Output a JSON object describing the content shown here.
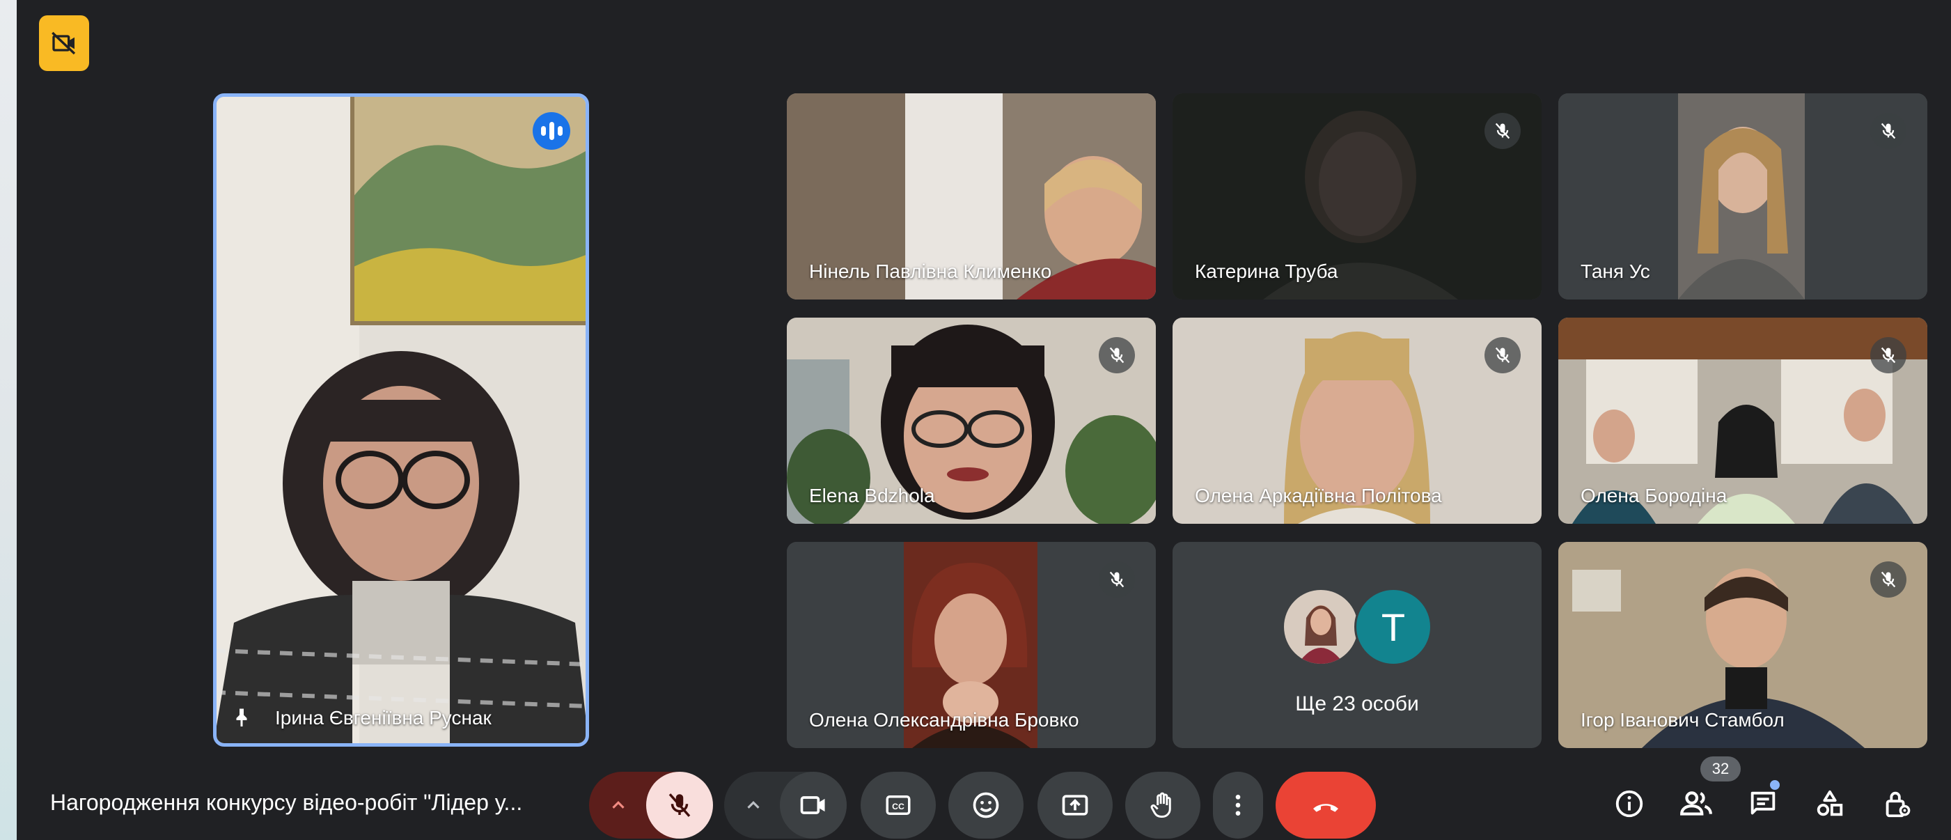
{
  "meeting": {
    "title": "Нагородження конкурсу відео-робіт \"Лідер у..."
  },
  "speaker": {
    "name": "Ірина Євгеніївна Руснак"
  },
  "participants": [
    {
      "name": "Нінель Павлівна Клименко"
    },
    {
      "name": "Катерина Труба"
    },
    {
      "name": "Таня Ус"
    },
    {
      "name": "Elena Bdzhola"
    },
    {
      "name": "Олена Аркадіївна Політова"
    },
    {
      "name": "Олена Бородіна"
    },
    {
      "name": "Олена Олександрівна Бровко"
    },
    {
      "name": "Ігор Іванович Стамбол"
    }
  ],
  "others": {
    "label": "Ще 23 особи",
    "avatar_letter": "T"
  },
  "people_count": "32",
  "colors": {
    "background": "#202124",
    "tile": "#3c4043",
    "hangup": "#ea4335",
    "speaker_border": "#8ab4f8",
    "record_badge": "#f9ba24",
    "muted_button": "#f9dedc",
    "avatar_t": "#12848f"
  },
  "icons": {
    "record": "recording-off-icon",
    "mic": "mic-off-icon",
    "camera": "videocam-icon",
    "captions": "closed-caption-icon",
    "emoji": "emoji-icon",
    "present": "present-to-all-icon",
    "hand": "raise-hand-icon",
    "more": "more-vert-icon",
    "hangup": "call-end-icon",
    "info": "info-icon",
    "people": "people-icon",
    "chat": "chat-icon",
    "activities": "activities-icon",
    "host": "host-controls-icon",
    "pin": "pin-icon"
  }
}
